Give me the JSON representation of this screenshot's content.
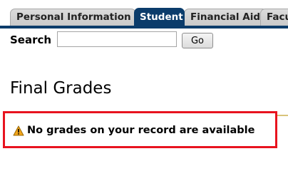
{
  "tabs": [
    {
      "label": "Personal Information",
      "active": false
    },
    {
      "label": "Student",
      "active": true
    },
    {
      "label": "Financial Aid",
      "active": false
    },
    {
      "label": "Faculty",
      "active": false
    }
  ],
  "search": {
    "label": "Search",
    "value": "",
    "button_label": "Go"
  },
  "page": {
    "title": "Final Grades"
  },
  "message": {
    "text": "No grades on your record are available",
    "icon": "warning-icon"
  },
  "colors": {
    "active_tab": "#0b3c6b",
    "highlight_border": "#e8131f",
    "warning_icon": "#f2a51a"
  }
}
